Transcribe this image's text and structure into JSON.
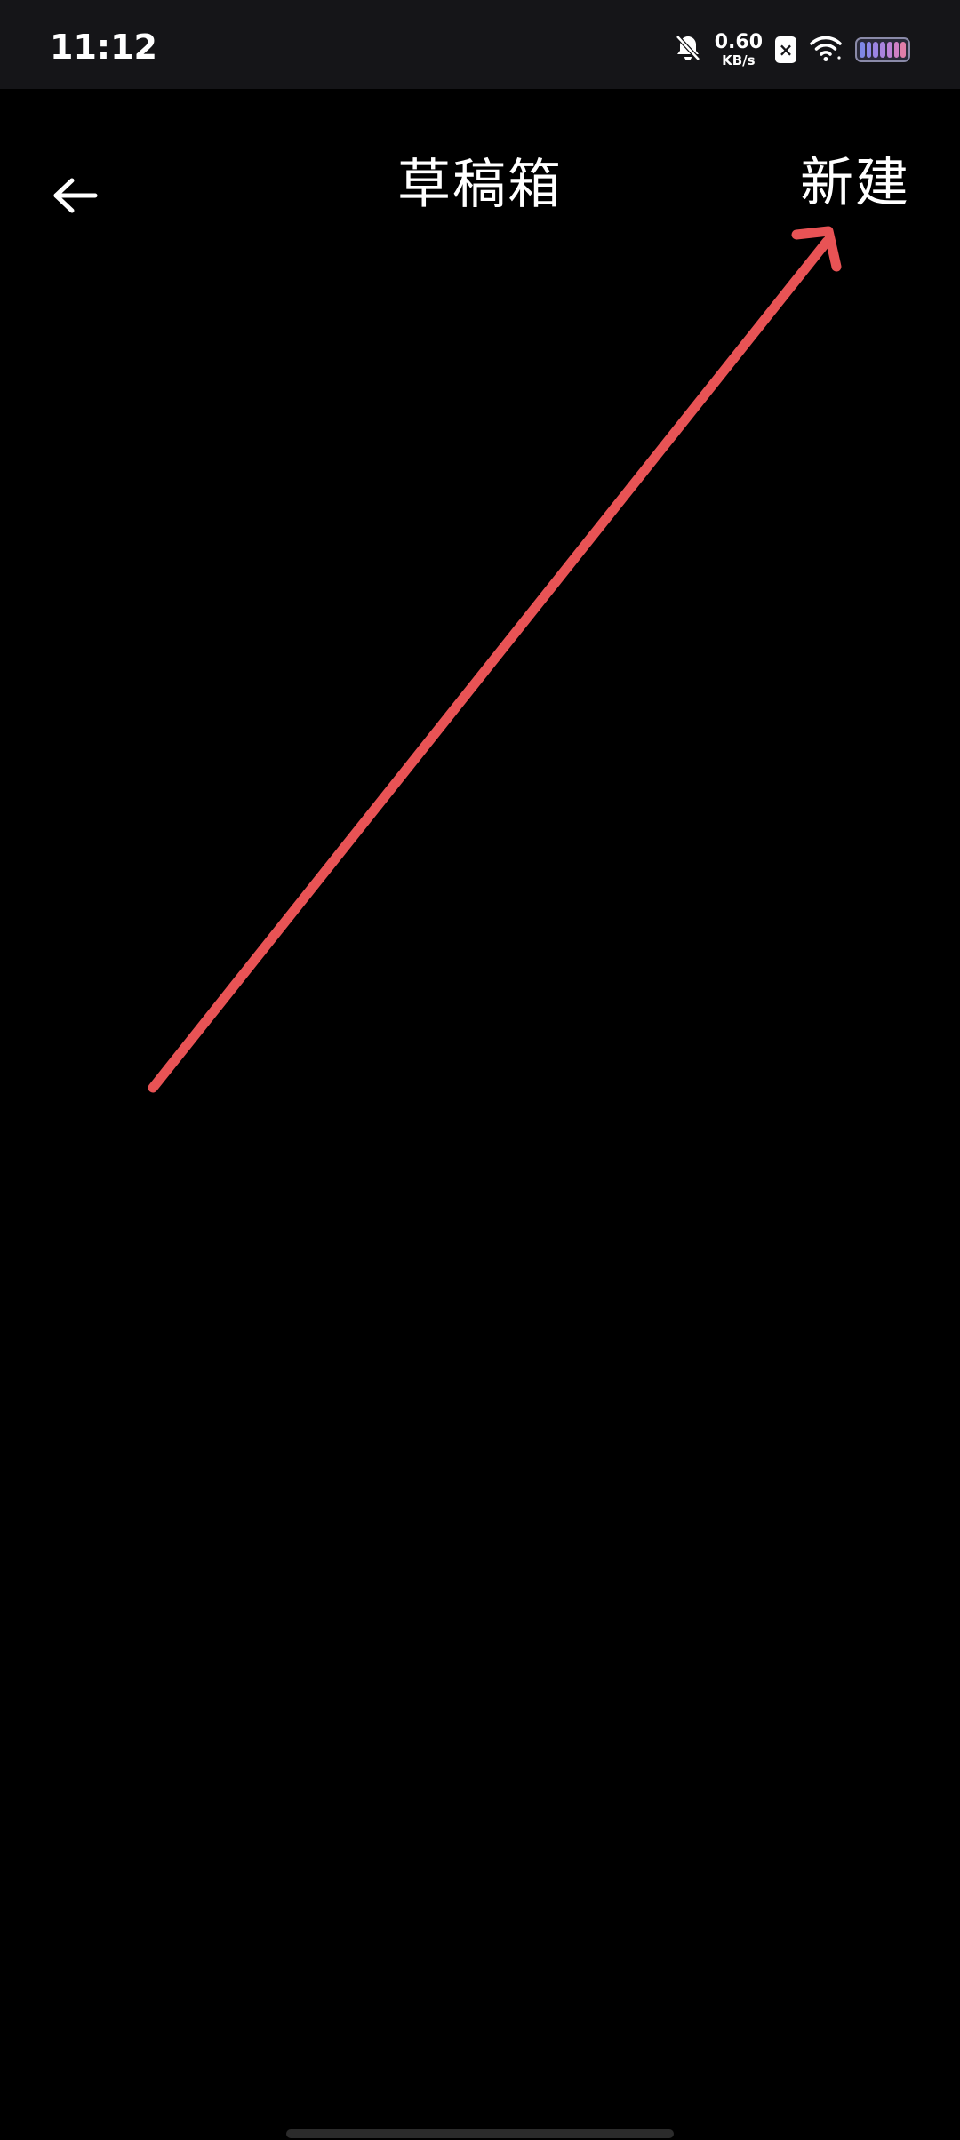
{
  "status_bar": {
    "time": "11:12",
    "net_speed_value": "0.60",
    "net_speed_unit": "KB/s",
    "icons": [
      "bell-muted-icon",
      "sim-disabled-icon",
      "wifi-icon",
      "battery-icon"
    ]
  },
  "header": {
    "title": "草稿箱",
    "back_icon": "arrow-left-icon",
    "new_label": "新建"
  },
  "annotation": {
    "type": "arrow",
    "color": "#E85355",
    "points_to": "new-button"
  },
  "colors": {
    "background": "#000000",
    "status_bar": "#151518",
    "text": "#FFFFFF",
    "annotation": "#E85355"
  }
}
